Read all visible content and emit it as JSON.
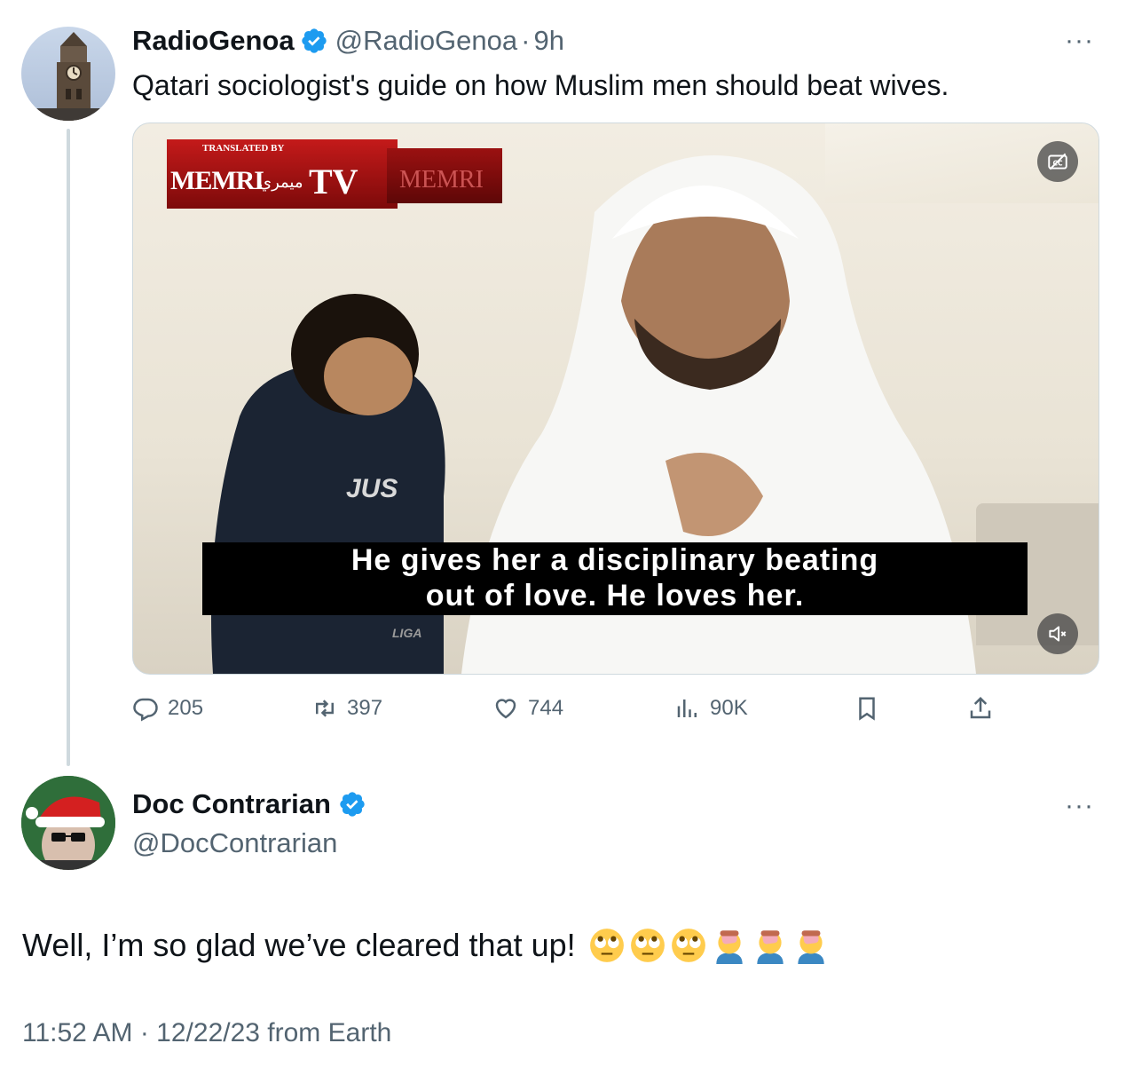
{
  "original_tweet": {
    "display_name": "RadioGenoa",
    "handle": "@RadioGenoa",
    "separator": "·",
    "time": "9h",
    "more_label": "···",
    "text": "Qatari sociologist's guide on how Muslim men should beat wives.",
    "avatar_icon": "clock-tower-avatar",
    "media": {
      "watermark_prefix": "TRANSLATED BY",
      "watermark_brand": "MEMRI",
      "watermark_arabic": "ميمري",
      "watermark_tv": "TV",
      "watermark_ghost": "MEMRI",
      "shirt_text": "JUS",
      "shirt_text_2": "LIGA",
      "caption_line_1": "He gives her a disciplinary beating",
      "caption_line_2": "out of love. He loves her.",
      "captions_icon": "captions-off-icon",
      "mute_icon": "volume-muted-icon"
    },
    "stats": {
      "replies": "205",
      "reposts": "397",
      "likes": "744",
      "views": "90K"
    }
  },
  "reply_tweet": {
    "display_name": "Doc Contrarian",
    "handle": "@DocContrarian",
    "more_label": "···",
    "text": "Well, I’m so glad we’ve cleared that up!",
    "emojis": [
      "rolling-eyes",
      "rolling-eyes",
      "rolling-eyes",
      "facepalm",
      "facepalm",
      "facepalm"
    ],
    "timestamp": "11:52 AM · 12/22/23 from Earth"
  },
  "colors": {
    "verified": "#1d9bf0",
    "secondary_text": "#536471",
    "divider": "#cfd9de"
  }
}
